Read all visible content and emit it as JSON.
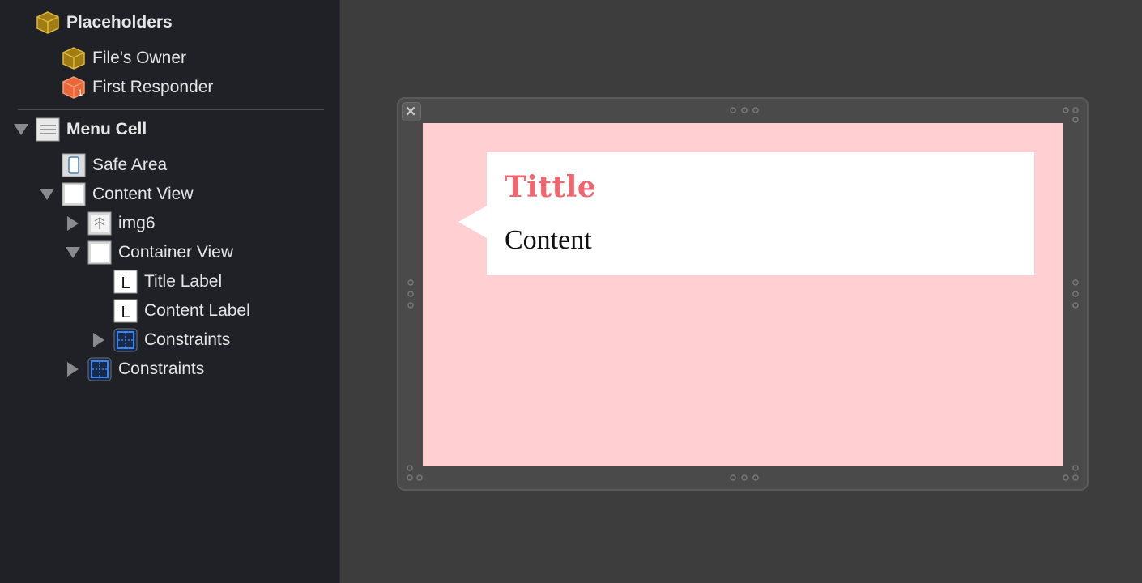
{
  "outline": {
    "placeholders": {
      "label": "Placeholders",
      "icon": "cube-icon"
    },
    "files_owner": {
      "label": "File's Owner",
      "icon": "cube-icon"
    },
    "first_responder": {
      "label": "First Responder",
      "icon": "first-responder-icon"
    },
    "menu_cell": {
      "label": "Menu Cell",
      "icon": "table-cell-icon",
      "expanded": true
    },
    "safe_area": {
      "label": "Safe Area",
      "icon": "safe-area-icon"
    },
    "content_view": {
      "label": "Content View",
      "icon": "view-icon",
      "expanded": true
    },
    "img6": {
      "label": "img6",
      "icon": "image-view-icon",
      "expanded": false
    },
    "container_view": {
      "label": "Container View",
      "icon": "view-icon",
      "expanded": true
    },
    "title_label": {
      "label": "Title Label",
      "icon": "label-icon",
      "glyph": "L"
    },
    "content_label": {
      "label": "Content Label",
      "icon": "label-icon",
      "glyph": "L"
    },
    "container_constraints": {
      "label": "Constraints",
      "icon": "constraints-icon",
      "expanded": false
    },
    "constraints": {
      "label": "Constraints",
      "icon": "constraints-icon",
      "expanded": false
    }
  },
  "canvas": {
    "title_text": "Tittle",
    "content_text": "Content",
    "colors": {
      "cell_background": "#ffcfd2",
      "title_color": "#f2646e",
      "bubble_background": "#ffffff",
      "sidebar_background": "#1f2126",
      "canvas_background": "#3d3d3d",
      "constraint_blue": "#3b82f6",
      "placeholder_gold": "#c9a227",
      "responder_orange": "#e8683a"
    }
  }
}
